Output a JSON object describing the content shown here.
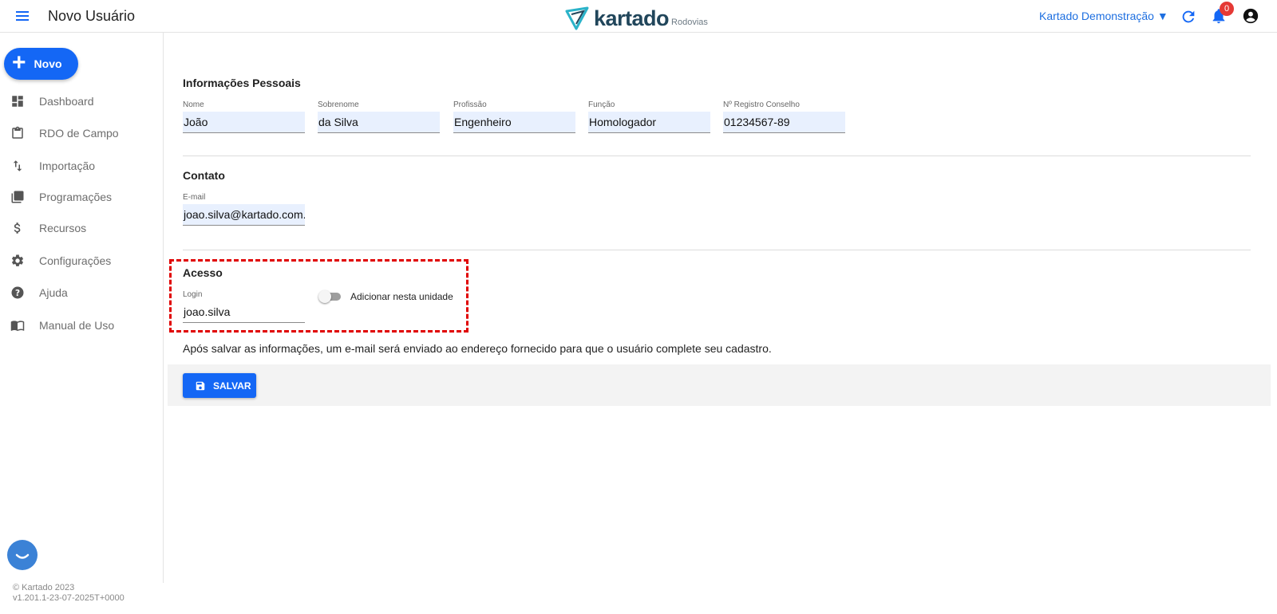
{
  "header": {
    "title": "Novo Usuário",
    "logo_word": "kartado",
    "logo_sub": "Rodovias",
    "org_selector": "Kartado Demonstração ▼",
    "notification_count": "0",
    "icons": [
      "menu-icon",
      "refresh-icon",
      "bell-icon",
      "account-circle-icon"
    ]
  },
  "sidebar": {
    "new_button": "Novo",
    "items": [
      {
        "label": "Dashboard",
        "icon": "dashboard-icon"
      },
      {
        "label": "RDO de Campo",
        "icon": "clipboard-icon"
      },
      {
        "label": "Importação",
        "icon": "import-arrows-icon"
      },
      {
        "label": "Programações",
        "icon": "library-books-icon"
      },
      {
        "label": "Recursos",
        "icon": "dollar-icon"
      },
      {
        "label": "Configurações",
        "icon": "gear-icon"
      },
      {
        "label": "Ajuda",
        "icon": "help-icon"
      },
      {
        "label": "Manual de Uso",
        "icon": "book-icon"
      }
    ],
    "footer": {
      "copyright": "© Kartado 2023",
      "version": "v1.201.1-23-07-2025T+0000"
    }
  },
  "form": {
    "personal": {
      "title": "Informações Pessoais",
      "fields": [
        {
          "label": "Nome",
          "value": "João"
        },
        {
          "label": "Sobrenome",
          "value": "da Silva"
        },
        {
          "label": "Profissão",
          "value": "Engenheiro"
        },
        {
          "label": "Função",
          "value": "Homologador"
        },
        {
          "label": "Nº Registro Conselho",
          "value": "01234567-89"
        }
      ]
    },
    "contact": {
      "title": "Contato",
      "email_label": "E-mail",
      "email_value": "joao.silva@kartado.com.b"
    },
    "access": {
      "title": "Acesso",
      "login_label": "Login",
      "login_value": "joao.silva",
      "toggle_label": "Adicionar nesta unidade",
      "toggle_on": false
    },
    "info_text": "Após salvar as informações, um e-mail será enviado ao endereço fornecido para que o usuário complete seu cadastro.",
    "save_label": "SALVAR"
  },
  "colors": {
    "primary": "#1467f5",
    "badge": "#e53935",
    "highlight": "#e00000",
    "field_bg": "#e8f0fe"
  }
}
